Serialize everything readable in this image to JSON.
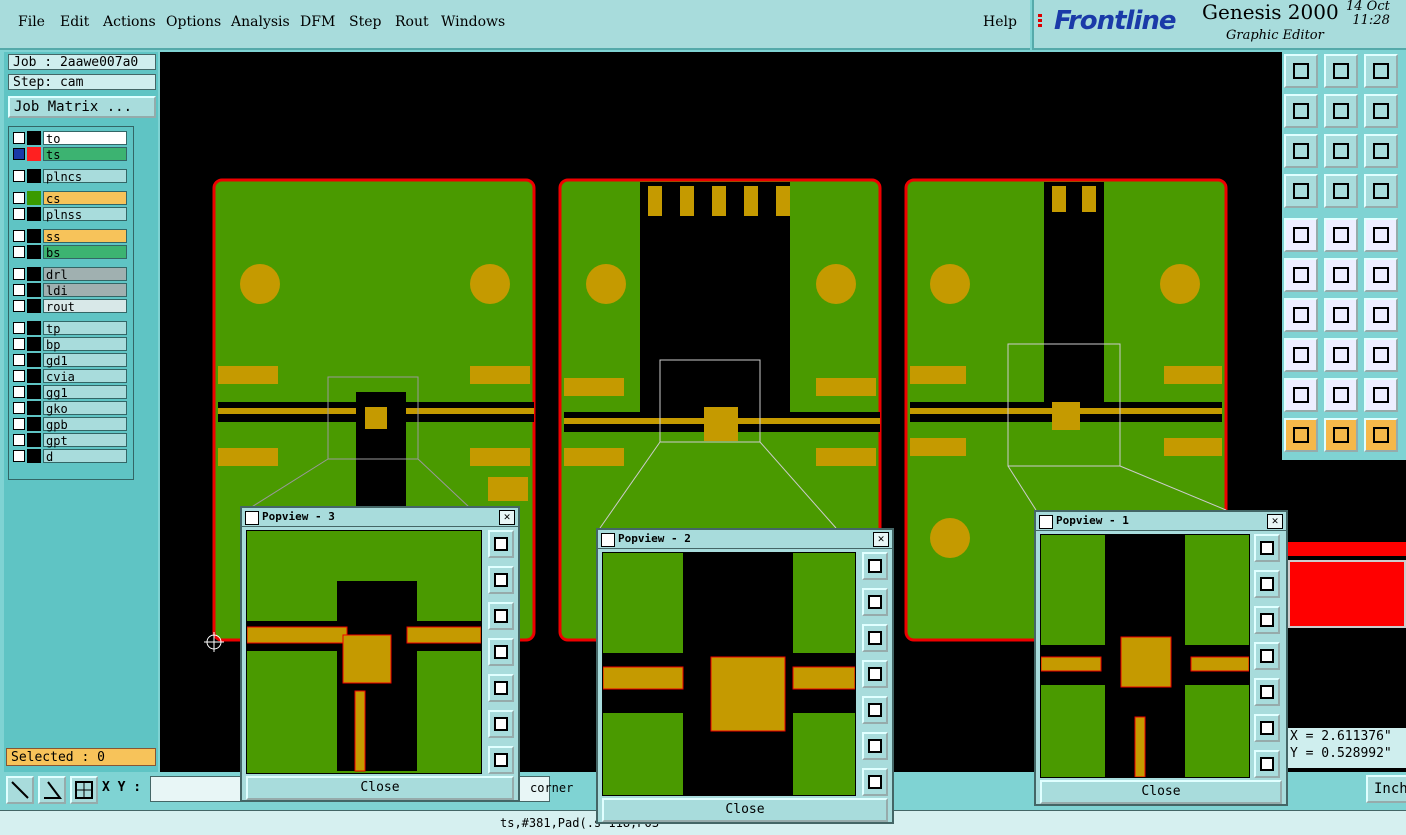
{
  "menu": [
    "File",
    "Edit",
    "Actions",
    "Options",
    "Analysis",
    "DFM",
    "Step",
    "Rout",
    "Windows"
  ],
  "help": "Help",
  "brand": {
    "logo": "Frontline",
    "app": "Genesis 2000",
    "subtitle": "Graphic Editor",
    "date": "14 Oct",
    "time": "11:28"
  },
  "job": {
    "label": "Job : 2aawe007a0",
    "step": "Step: cam",
    "matrix": "Job Matrix ..."
  },
  "layers": [
    {
      "name": "to",
      "color": "#ffffff",
      "swatch": "#000000"
    },
    {
      "name": "ts",
      "color": "#3cb371",
      "swatch": "#ff2020",
      "active": true
    },
    {
      "name": "plncs",
      "color": "#a8dcdc",
      "swatch": "#000000"
    },
    {
      "name": "cs",
      "color": "#f7c35a",
      "swatch": "#3a9a00"
    },
    {
      "name": "plnss",
      "color": "#a8dcdc",
      "swatch": "#000000"
    },
    {
      "name": "ss",
      "color": "#f7c35a",
      "swatch": "#000000"
    },
    {
      "name": "bs",
      "color": "#3cb371",
      "swatch": "#000000"
    },
    {
      "name": "drl",
      "color": "#a0b0b0",
      "swatch": "#000000"
    },
    {
      "name": "ldi",
      "color": "#a0b0b0",
      "swatch": "#000000"
    },
    {
      "name": "rout",
      "color": "#d8e8e8",
      "swatch": "#000000"
    },
    {
      "name": "tp",
      "color": "#a8dcdc",
      "swatch": "#000000"
    },
    {
      "name": "bp",
      "color": "#a8dcdc",
      "swatch": "#000000"
    },
    {
      "name": "gd1",
      "color": "#a8dcdc",
      "swatch": "#000000"
    },
    {
      "name": "cvia",
      "color": "#a8dcdc",
      "swatch": "#000000"
    },
    {
      "name": "gg1",
      "color": "#a8dcdc",
      "swatch": "#000000"
    },
    {
      "name": "gko",
      "color": "#a8dcdc",
      "swatch": "#000000"
    },
    {
      "name": "gpb",
      "color": "#a8dcdc",
      "swatch": "#000000"
    },
    {
      "name": "gpt",
      "color": "#a8dcdc",
      "swatch": "#000000"
    },
    {
      "name": "d",
      "color": "#a8dcdc",
      "swatch": "#000000"
    }
  ],
  "selected": "Selected : 0",
  "coords": {
    "x": "X = 2.611376\"",
    "y": "Y = 0.528992\""
  },
  "xy_label": "X Y :",
  "corner": "corner",
  "units": "Inch",
  "status": "ts,#381,Pad(.s                                 118,POS",
  "popups": [
    {
      "title": "Popview - 3",
      "close": "Close"
    },
    {
      "title": "Popview - 2",
      "close": "Close"
    },
    {
      "title": "Popview - 1",
      "close": "Close"
    }
  ],
  "colors": {
    "board": "#4a9a00",
    "copper": "#c59a00",
    "outline": "#e00000",
    "bg": "#000000",
    "panel": "#7fd3d3"
  }
}
